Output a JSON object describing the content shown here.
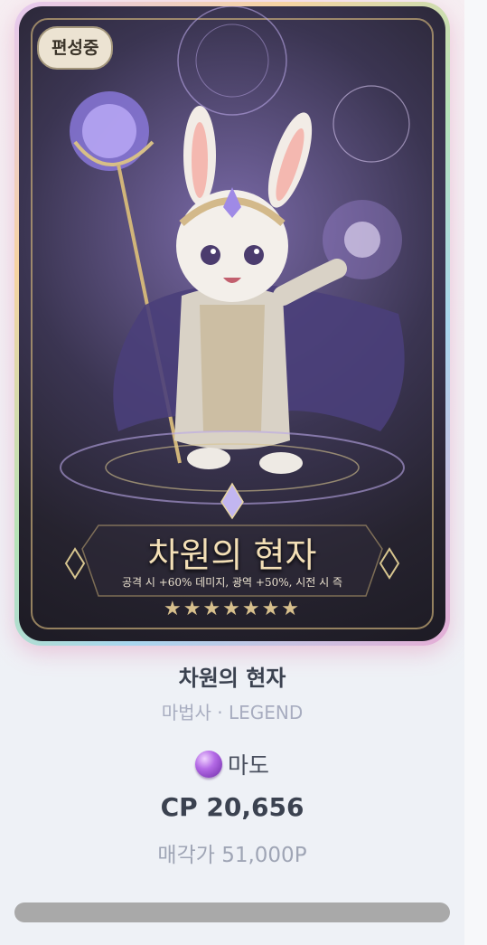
{
  "card": {
    "status_badge": "편성중",
    "title": "차원의 현자",
    "description": "공격 시 +60% 데미지, 광역 +50%, 시전 시 즉",
    "stars": "★★★★★★★"
  },
  "info": {
    "name": "차원의 현자",
    "subtitle": "마법사 · LEGEND",
    "element_icon": "purple-orb-icon",
    "element_label": "마도",
    "cp_text": "CP 20,656",
    "sell_text": "매각가 51,000P"
  },
  "colors": {
    "accent_text": "#3b4250",
    "muted_text": "#a8adc0",
    "badge_bg": "#ece3d2"
  }
}
